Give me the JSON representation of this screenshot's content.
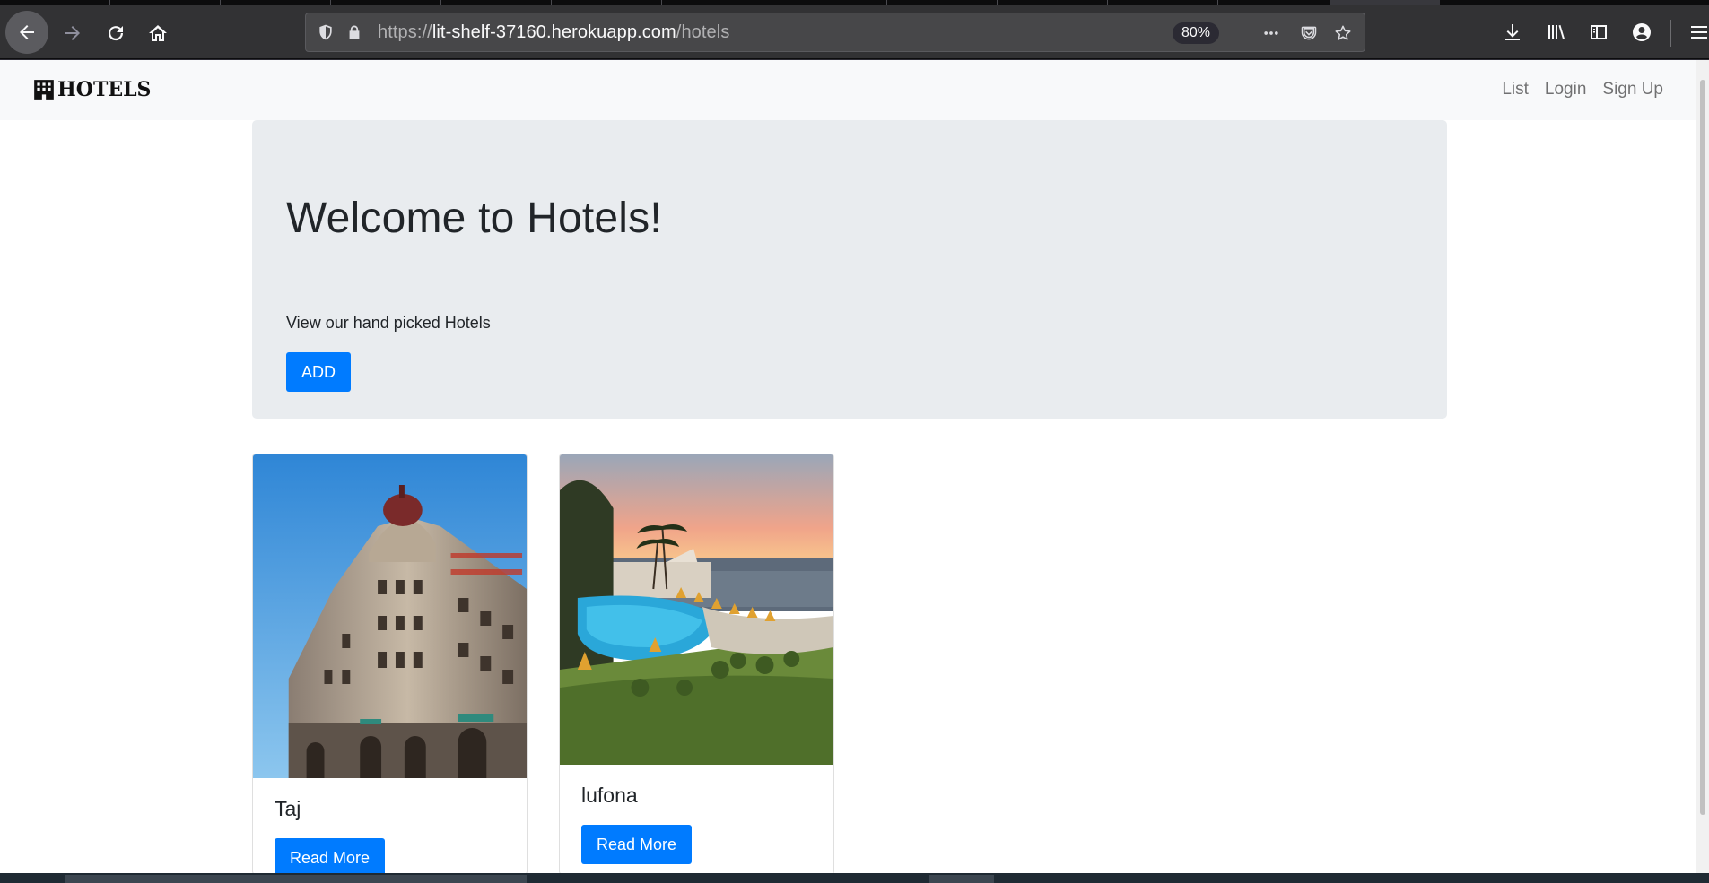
{
  "browser": {
    "url_prefix": "https://",
    "url_host": "lit-shelf-37160.herokuapp.com",
    "url_path": "/hotels",
    "zoom": "80%"
  },
  "navbar": {
    "brand": "HOTELS",
    "links": [
      "List",
      "Login",
      "Sign Up"
    ]
  },
  "jumbotron": {
    "heading": "Welcome to Hotels!",
    "subtitle": "View our hand picked Hotels",
    "add_label": "ADD"
  },
  "cards": [
    {
      "title": "Taj",
      "button": "Read More",
      "image": "taj-hotel-photo"
    },
    {
      "title": "lufona",
      "button": "Read More",
      "image": "resort-pool-sunset-photo"
    }
  ],
  "colors": {
    "primary": "#007bff",
    "jumbotron_bg": "#e9ecef",
    "navbar_bg": "#f8f9fa"
  }
}
